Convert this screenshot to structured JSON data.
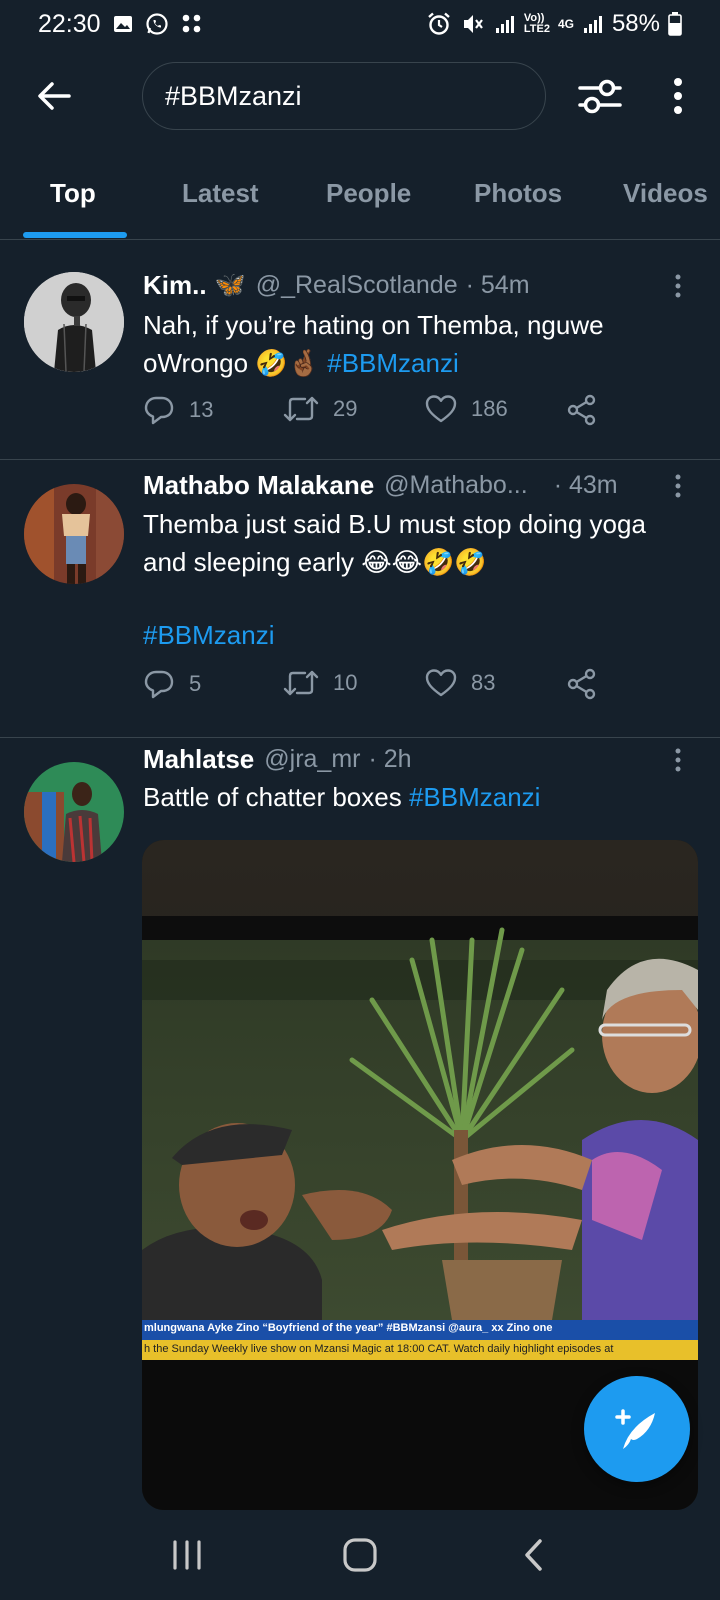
{
  "status_bar": {
    "time": "22:30",
    "battery": "58%",
    "network": "4G",
    "carrier_tag_top": "Vo))",
    "carrier_tag_bottom": "LTE2"
  },
  "search": {
    "query": "#BBMzanzi"
  },
  "tabs": [
    "Top",
    "Latest",
    "People",
    "Photos",
    "Videos"
  ],
  "active_tab": "Top",
  "tweets": [
    {
      "name": "Kim..",
      "emoji_after_name": "🦋",
      "handle": "@_RealScotlande",
      "time": "· 54m",
      "text": "Nah, if you’re hating on Themba, nguwe oWrongo 🤣🤞🏾 ",
      "hashtag": "#BBMzanzi",
      "replies": "13",
      "retweets": "29",
      "likes": "186"
    },
    {
      "name": "Mathabo Malakane",
      "handle": "@Mathabo...",
      "time": "· 43m",
      "text": "Themba just said B.U must stop doing yoga and sleeping early 😂😂🤣🤣",
      "hashtag": "#BBMzanzi",
      "replies": "5",
      "retweets": "10",
      "likes": "83"
    },
    {
      "name": "Mahlatse",
      "handle": "@jra_mr",
      "time": "· 2h",
      "text": "Battle of chatter boxes ",
      "hashtag": "#BBMzanzi",
      "media": {
        "ticker_top": "mlungwana Ayke Zino “Boyfriend of the year” #BBMzansi   @aura_ xx Zino one",
        "ticker_bottom": "h the Sunday Weekly live show on Mzansi Magic at 18:00 CAT. Watch daily highlight episodes at"
      }
    }
  ],
  "colors": {
    "background": "#15202b",
    "accent": "#1d9bf0",
    "secondary_text": "#8b98a5",
    "divider": "#38444d"
  }
}
